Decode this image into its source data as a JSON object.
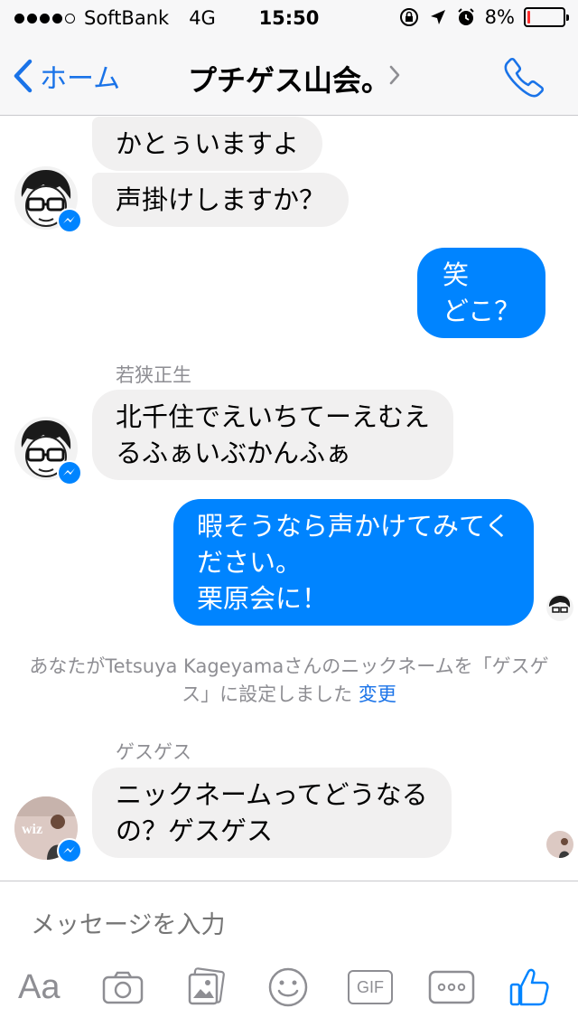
{
  "status_bar": {
    "carrier": "SoftBank",
    "network": "4G",
    "time": "15:50",
    "battery_percent": "8%",
    "battery_level": 0.08,
    "signal_bars_filled": 4
  },
  "nav": {
    "back_label": "ホーム",
    "title": "プチゲス山会。"
  },
  "messages": {
    "m1": "かとぅいますよ",
    "m2": "声掛けしますか？",
    "m3": "笑\nどこ？",
    "sender1": "若狭正生",
    "m4": "北千住でえいちてーえむえ\nるふぁいぶかんふぁ",
    "m5": "暇そうなら声かけてみてく\nださい。\n栗原会に！",
    "system_text": "あなたがTetsuya Kageyamaさんのニックネームを「ゲスゲス」に設定しました",
    "system_link": "変更",
    "sender2": "ゲスゲス",
    "m6": "ニックネームってどうなる\nの？ゲスゲス",
    "avatar_label": "wiz"
  },
  "composer": {
    "placeholder": "メッセージを入力",
    "aa_label": "Aa",
    "gif_label": "GIF"
  },
  "colors": {
    "accent": "#0084ff",
    "link": "#1a73e8",
    "incoming_bubble": "#f1f0f0",
    "battery_low": "#ff2d2d"
  },
  "icons": [
    "chevron-left-icon",
    "chevron-right-icon",
    "phone-icon",
    "messenger-badge-icon",
    "camera-icon",
    "photo-icon",
    "emoji-icon",
    "gif-icon",
    "more-icon",
    "thumbs-up-icon"
  ]
}
